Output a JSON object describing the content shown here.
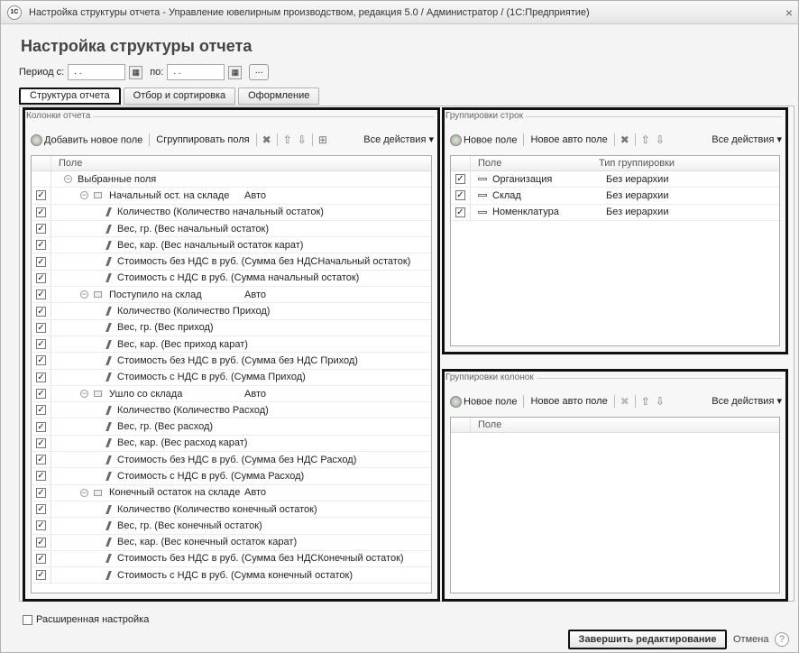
{
  "window": {
    "title": "Настройка структуры отчета - Управление ювелирным производством, редакция 5.0 / Администратор / (1С:Предприятие)",
    "logo": "1С",
    "close": "×"
  },
  "page_title": "Настройка структуры отчета",
  "period": {
    "from_label": "Период с:",
    "from_value": " .  .",
    "to_label": "по:",
    "to_value": " .  .",
    "select_label": "..."
  },
  "tabs": [
    "Структура отчета",
    "Отбор и сортировка",
    "Оформление"
  ],
  "columns_panel": {
    "title": "Колонки отчета",
    "toolbar": {
      "add": "Добавить новое поле",
      "group": "Сгруппировать поля",
      "all": "Все действия ▾"
    },
    "header": "Поле",
    "rows": [
      {
        "level": 0,
        "type": "root",
        "checked": false,
        "label": "Выбранные поля",
        "extra": ""
      },
      {
        "level": 1,
        "type": "group",
        "checked": true,
        "label": "Начальный ост. на складе",
        "extra": "Авто"
      },
      {
        "level": 2,
        "type": "field",
        "checked": true,
        "label": "Количество (Количество начальный остаток)",
        "extra": ""
      },
      {
        "level": 2,
        "type": "field",
        "checked": true,
        "label": "Вес, гр. (Вес начальный остаток)",
        "extra": ""
      },
      {
        "level": 2,
        "type": "field",
        "checked": true,
        "label": "Вес, кар. (Вес начальный остаток карат)",
        "extra": ""
      },
      {
        "level": 2,
        "type": "field",
        "checked": true,
        "label": "Стоимость без НДС в руб. (Сумма без НДСНачальный остаток)",
        "extra": ""
      },
      {
        "level": 2,
        "type": "field",
        "checked": true,
        "label": "Стоимость с НДС в руб. (Сумма начальный остаток)",
        "extra": ""
      },
      {
        "level": 1,
        "type": "group",
        "checked": true,
        "label": "Поступило на склад",
        "extra": "Авто"
      },
      {
        "level": 2,
        "type": "field",
        "checked": true,
        "label": "Количество (Количество Приход)",
        "extra": ""
      },
      {
        "level": 2,
        "type": "field",
        "checked": true,
        "label": "Вес, гр. (Вес приход)",
        "extra": ""
      },
      {
        "level": 2,
        "type": "field",
        "checked": true,
        "label": "Вес, кар. (Вес приход карат)",
        "extra": ""
      },
      {
        "level": 2,
        "type": "field",
        "checked": true,
        "label": "Стоимость без НДС в руб. (Сумма без НДС Приход)",
        "extra": ""
      },
      {
        "level": 2,
        "type": "field",
        "checked": true,
        "label": "Стоимость с НДС в руб. (Сумма Приход)",
        "extra": ""
      },
      {
        "level": 1,
        "type": "group",
        "checked": true,
        "label": "Ушло со склада",
        "extra": "Авто"
      },
      {
        "level": 2,
        "type": "field",
        "checked": true,
        "label": "Количество (Количество Расход)",
        "extra": ""
      },
      {
        "level": 2,
        "type": "field",
        "checked": true,
        "label": "Вес, гр. (Вес расход)",
        "extra": ""
      },
      {
        "level": 2,
        "type": "field",
        "checked": true,
        "label": "Вес, кар. (Вес расход карат)",
        "extra": ""
      },
      {
        "level": 2,
        "type": "field",
        "checked": true,
        "label": "Стоимость без НДС в руб. (Сумма без НДС Расход)",
        "extra": ""
      },
      {
        "level": 2,
        "type": "field",
        "checked": true,
        "label": "Стоимость с НДС в руб. (Сумма Расход)",
        "extra": ""
      },
      {
        "level": 1,
        "type": "group",
        "checked": true,
        "label": "Конечный остаток на складе",
        "extra": "Авто"
      },
      {
        "level": 2,
        "type": "field",
        "checked": true,
        "label": "Количество (Количество конечный остаток)",
        "extra": ""
      },
      {
        "level": 2,
        "type": "field",
        "checked": true,
        "label": "Вес, гр. (Вес конечный остаток)",
        "extra": ""
      },
      {
        "level": 2,
        "type": "field",
        "checked": true,
        "label": "Вес, кар. (Вес конечный остаток карат)",
        "extra": ""
      },
      {
        "level": 2,
        "type": "field",
        "checked": true,
        "label": "Стоимость без НДС в руб. (Сумма без НДСКонечный остаток)",
        "extra": ""
      },
      {
        "level": 2,
        "type": "field",
        "checked": true,
        "label": "Стоимость с НДС в руб. (Сумма конечный остаток)",
        "extra": ""
      }
    ]
  },
  "row_groups_panel": {
    "title": "Группировки строк",
    "toolbar": {
      "new": "Новое поле",
      "new_auto": "Новое авто поле",
      "all": "Все действия ▾"
    },
    "headers": [
      "Поле",
      "Тип группировки"
    ],
    "rows": [
      {
        "checked": true,
        "label": "Организация",
        "type": "Без иерархии"
      },
      {
        "checked": true,
        "label": "Склад",
        "type": "Без иерархии"
      },
      {
        "checked": true,
        "label": "Номенклатура",
        "type": "Без иерархии"
      }
    ]
  },
  "col_groups_panel": {
    "title": "Группировки колонок",
    "toolbar": {
      "new": "Новое поле",
      "new_auto": "Новое авто поле",
      "all": "Все действия ▾"
    },
    "header": "Поле"
  },
  "advanced_label": "Расширенная настройка",
  "finish_button": "Завершить редактирование",
  "cancel_label": "Отмена",
  "help_label": "?"
}
